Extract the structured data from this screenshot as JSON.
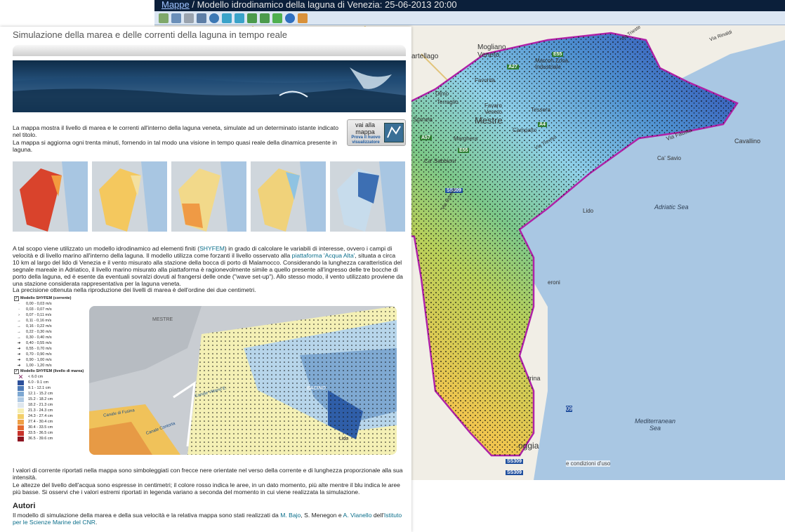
{
  "map_window": {
    "breadcrumb": "Mappe",
    "title": "/ Modello idrodinamico della laguna di Venezia: 25-06-2013 20:00",
    "places": [
      "Mogliano Veneto",
      "Marcon Zona Industriale",
      "artellago",
      "Favorita",
      "Olmo",
      "Terraglio",
      "Favaro Veneto",
      "Tessera",
      "Spinea",
      "Mestre",
      "Campalto",
      "Marghera",
      "Ca' Sabbioni",
      "Cavallino",
      "Ca' Savio",
      "Via Fausta",
      "Adriatic Sea",
      "Mediterranean Sea",
      "Lido",
      "eroni",
      "trina",
      "oggia"
    ],
    "roads": [
      "E55",
      "A27",
      "A4",
      "A57",
      "E55",
      "SS309",
      "SS309",
      "SS309",
      "Via Trieste",
      "Via Rinaldi",
      "Via Treviso",
      "Via Romea"
    ],
    "footer": "e condizioni d'uso",
    "corner_label": "09"
  },
  "page": {
    "title": "Simulazione della marea e delle correnti della laguna in tempo reale",
    "intro1": "La mappa mostra il livello di marea e le correnti all'interno della laguna veneta, simulate ad un determinato istante indicato nel titolo.",
    "intro2": "La mappa si aggiorna ogni trenta minuti, fornendo in tal modo una visione in tempo quasi reale della dinamica presente in laguna.",
    "vai_button": {
      "label": "vai alla mappa",
      "sub": "Prova il nuovo visualizzatore"
    },
    "para1_a": "A tal scopo viene utilizzato un modello idrodinamico ad elementi finiti (",
    "para1_link1": "SHYFEM",
    "para1_b": ") in grado di calcolare le variabili di interesse, ovvero i campi di velocità e di livello marino all'interno della laguna. Il modello utilizza come forzanti il livello osservato alla ",
    "para1_link2": "piattaforma 'Acqua Alta'",
    "para1_c": ", situata a circa 10 km al largo del lido di Venezia e il vento misurato alla stazione della bocca di porto di Malamocco. Considerando la lunghezza caratteristica del segnale mareale in Adriatico, il livello marino misurato alla piattaforma è ragionevolmente simile a quello presente all'ingresso delle tre bocche di porto della laguna, ed è esente da eventuali sovralzi dovuti al frangersi delle onde (\"wave set-up\"). Allo stesso modo, il vento utilizzato proviene da una stazione considerata rappresentativa per la laguna veneta.",
    "para2": "La precisione ottenuta nella riproduzione dei livelli di marea è dell'ordine dei due centimetri.",
    "para3": "I valori di corrente riportati nella mappa sono simboleggiati con frecce nere orientate nel verso della corrente e di lunghezza proporzionale alla sua intensità.",
    "para4": "Le altezze del livello dell'acqua sono espresse in centimetri; il colore rosso indica le aree, in un dato momento, più alte mentre il blu indica le aree più basse. Si osservi che i valori estremi riportati in legenda variano a seconda del momento in cui viene realizzata la simulazione.",
    "autori_heading": "Autori",
    "autori_a": "Il modello di simulazione della marea e della sua velocità e la relativa mappa sono stati realizzati da ",
    "autori_n1": "M. Bajo",
    "autori_b": ", S. Menegon e ",
    "autori_n2": "A. Vianello",
    "autori_c": " dell'",
    "autori_link": "Istituto per le Scienze Marine del CNR",
    "autori_d": "."
  },
  "legend": {
    "current_title": "Modello SHYFEM (corrente)",
    "current_rows": [
      "0,00 - 0,03 m/s",
      "0,03 - 0,07 m/s",
      "0,07 - 0,11 m/s",
      "0,11 - 0,16 m/s",
      "0,16 - 0,22 m/s",
      "0,22 - 0,30 m/s",
      "0,30 - 0,40 m/s",
      "0,40 - 0,55 m/s",
      "0,55 - 0,70 m/s",
      "0,70 - 0,90 m/s",
      "0,90 - 1,00 m/s",
      "1,00 - 1,20 m/s"
    ],
    "level_title": "Modello SHYFEM (livello di marea)",
    "level_rows": [
      {
        "label": "< 6.0 cm",
        "color": "#7a1a5a"
      },
      {
        "label": "6.0 - 9.1 cm",
        "color": "#2c4f9a"
      },
      {
        "label": "9.1 - 12.1 cm",
        "color": "#4d7bb8"
      },
      {
        "label": "12.1 - 15.2 cm",
        "color": "#7ea8d2"
      },
      {
        "label": "15.2 - 18.2 cm",
        "color": "#b1cbe4"
      },
      {
        "label": "18.2 - 21.3 cm",
        "color": "#dfe7ee"
      },
      {
        "label": "21.3 - 24.3 cm",
        "color": "#f6efb3"
      },
      {
        "label": "24.3 - 27.4 cm",
        "color": "#f3cf6a"
      },
      {
        "label": "27.4 - 30.4 cm",
        "color": "#ef9f45"
      },
      {
        "label": "30.4 - 33.5 cm",
        "color": "#e46a2f"
      },
      {
        "label": "33.5 - 36.5 cm",
        "color": "#c8322a"
      },
      {
        "label": "36.5 - 39.6 cm",
        "color": "#8d1421"
      }
    ]
  },
  "detail_map": {
    "labels": [
      "MESTRE",
      "BACINO",
      "Lido",
      "Canale Vittorio E.",
      "Canale Contorta",
      "Canale di Fusina"
    ]
  }
}
